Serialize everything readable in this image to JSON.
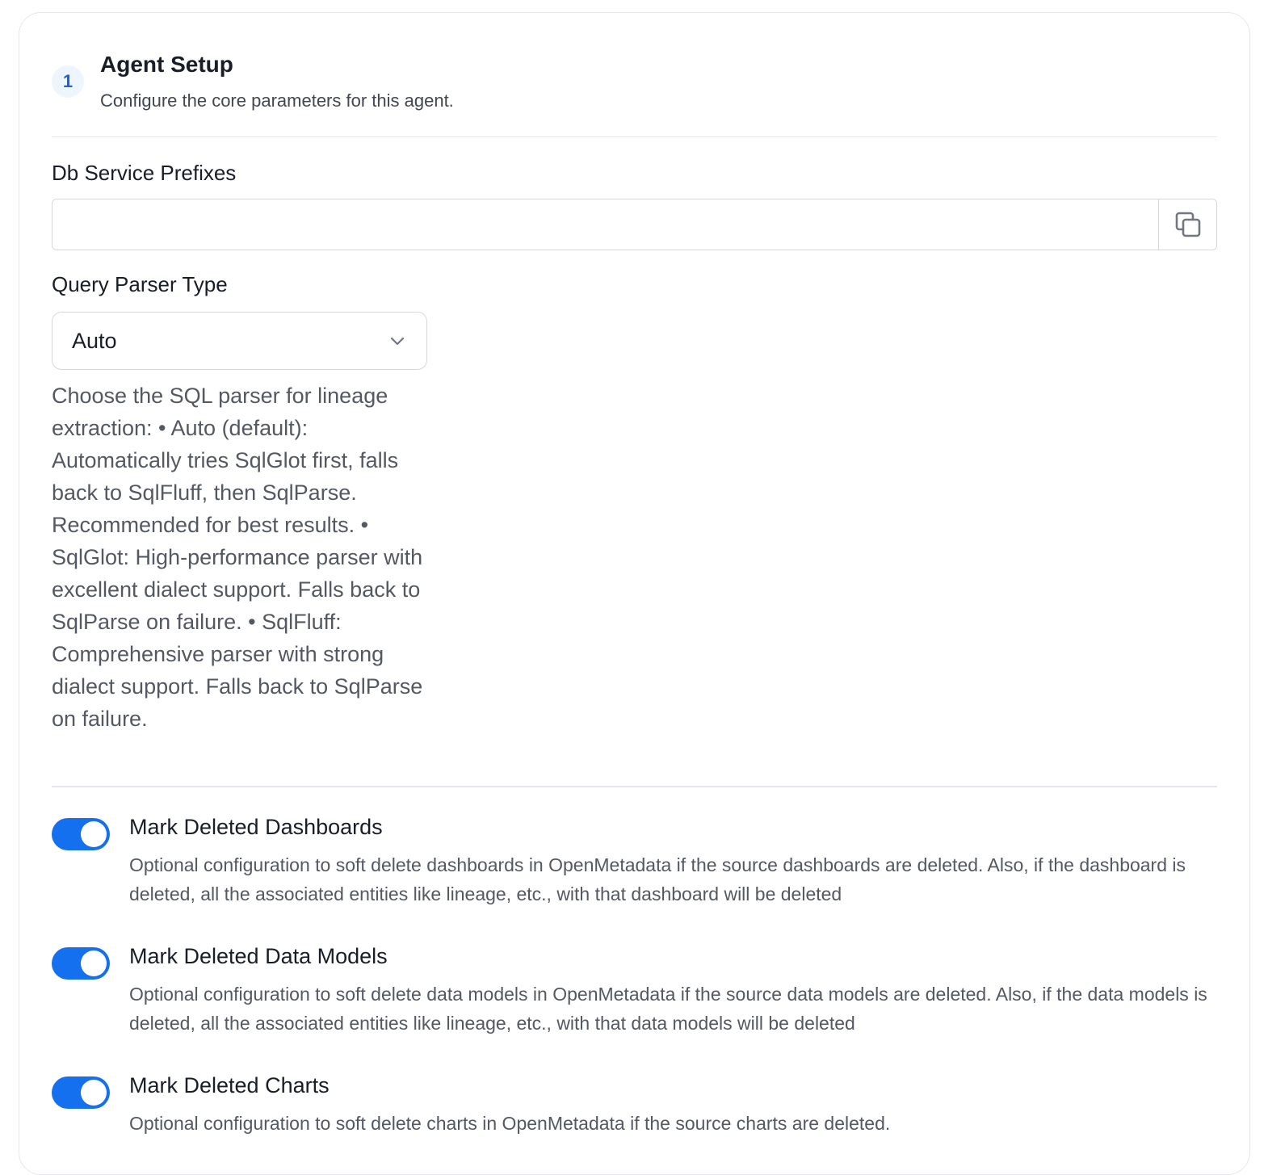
{
  "section": {
    "step": "1",
    "title": "Agent Setup",
    "subtitle": "Configure the core parameters for this agent."
  },
  "db_service_prefixes": {
    "label": "Db Service Prefixes",
    "value": "",
    "placeholder": ""
  },
  "query_parser_type": {
    "label": "Query Parser Type",
    "selected": "Auto",
    "help": "Choose the SQL parser for lineage extraction: • Auto (default): Automatically tries SqlGlot first, falls back to SqlFluff, then SqlParse. Recommended for best results. • SqlGlot: High-performance parser with excellent dialect support. Falls back to SqlParse on failure. • SqlFluff: Comprehensive parser with strong dialect support. Falls back to SqlParse on failure."
  },
  "toggles": [
    {
      "title": "Mark Deleted Dashboards",
      "description": "Optional configuration to soft delete dashboards in OpenMetadata if the source dashboards are deleted. Also, if the dashboard is deleted, all the associated entities like lineage, etc., with that dashboard will be deleted",
      "enabled": true
    },
    {
      "title": "Mark Deleted Data Models",
      "description": "Optional configuration to soft delete data models in OpenMetadata if the source data models are deleted. Also, if the data models is deleted, all the associated entities like lineage, etc., with that data models will be deleted",
      "enabled": true
    },
    {
      "title": "Mark Deleted Charts",
      "description": "Optional configuration to soft delete charts in OpenMetadata if the source charts are deleted.",
      "enabled": true
    }
  ],
  "colors": {
    "accent": "#1570ef",
    "step_badge_bg": "#eff5ff",
    "border": "#d5d7da",
    "divider": "#e4e7ec"
  },
  "icons": {
    "copy": "copy-icon",
    "dropdown": "chevron-down-icon"
  }
}
